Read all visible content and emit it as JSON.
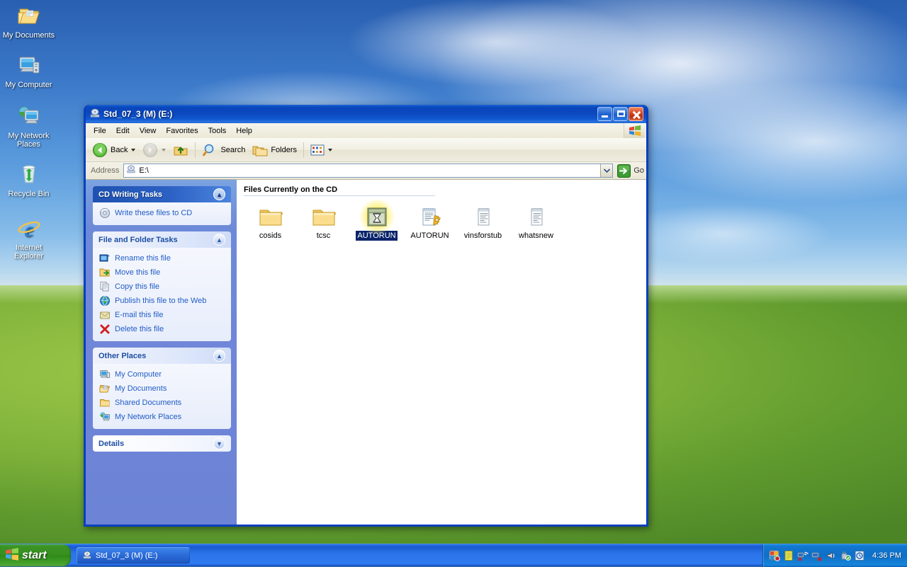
{
  "desktop": {
    "icons": [
      {
        "label": "My Documents",
        "icon": "my-documents-icon"
      },
      {
        "label": "My Computer",
        "icon": "my-computer-icon"
      },
      {
        "label": "My Network Places",
        "icon": "my-network-places-icon"
      },
      {
        "label": "Recycle Bin",
        "icon": "recycle-bin-icon"
      },
      {
        "label": "Internet Explorer",
        "icon": "internet-explorer-icon"
      }
    ]
  },
  "window": {
    "title": "Std_07_3 (M) (E:)",
    "title_icon": "cd-drive-icon",
    "controls": {
      "minimize": "Minimize",
      "maximize": "Maximize",
      "close": "Close"
    },
    "menu": [
      "File",
      "Edit",
      "View",
      "Favorites",
      "Tools",
      "Help"
    ],
    "toolbar": {
      "back": "Back",
      "forward": "Forward",
      "up": "Up",
      "search": "Search",
      "folders": "Folders",
      "views": "Views"
    },
    "address": {
      "label": "Address",
      "value": "E:\\",
      "go": "Go"
    },
    "sidebar": {
      "panels": [
        {
          "title": "CD Writing Tasks",
          "style": "dark",
          "chevron": "chevron-up",
          "items": [
            {
              "label": "Write these files to CD",
              "icon": "cd-write-icon"
            }
          ]
        },
        {
          "title": "File and Folder Tasks",
          "style": "light",
          "chevron": "chevron-up",
          "items": [
            {
              "label": "Rename this file",
              "icon": "rename-icon"
            },
            {
              "label": "Move this file",
              "icon": "move-icon"
            },
            {
              "label": "Copy this file",
              "icon": "copy-icon"
            },
            {
              "label": "Publish this file to the Web",
              "icon": "publish-web-icon"
            },
            {
              "label": "E-mail this file",
              "icon": "email-icon"
            },
            {
              "label": "Delete this file",
              "icon": "delete-icon"
            }
          ]
        },
        {
          "title": "Other Places",
          "style": "light",
          "chevron": "chevron-up",
          "items": [
            {
              "label": "My Computer",
              "icon": "my-computer-icon"
            },
            {
              "label": "My Documents",
              "icon": "my-documents-icon"
            },
            {
              "label": "Shared Documents",
              "icon": "shared-documents-icon"
            },
            {
              "label": "My Network Places",
              "icon": "my-network-places-icon"
            }
          ]
        },
        {
          "title": "Details",
          "style": "light",
          "chevron": "chevron-down",
          "items": []
        }
      ]
    },
    "content": {
      "group_header": "Files Currently on the CD",
      "files": [
        {
          "name": "cosids",
          "type": "folder",
          "selected": false,
          "hover": false
        },
        {
          "name": "tcsc",
          "type": "folder",
          "selected": false,
          "hover": false
        },
        {
          "name": "AUTORUN",
          "type": "application",
          "selected": true,
          "hover": true
        },
        {
          "name": "AUTORUN",
          "type": "setup-information",
          "selected": false,
          "hover": false
        },
        {
          "name": "vinsforstub",
          "type": "text-document",
          "selected": false,
          "hover": false
        },
        {
          "name": "whatsnew",
          "type": "text-document",
          "selected": false,
          "hover": false
        }
      ]
    }
  },
  "taskbar": {
    "start_label": "start",
    "tasks": [
      {
        "label": "Std_07_3 (M) (E:)",
        "icon": "cd-drive-icon",
        "active": true
      }
    ],
    "tray_icons": [
      "security-center-icon",
      "document-icon",
      "network-disconnected-icon",
      "network-error-icon",
      "volume-icon",
      "safely-remove-hardware-icon",
      "windows-update-icon"
    ],
    "clock": "4:36 PM"
  },
  "colors": {
    "title_blue": "#0a45bb",
    "sidebar_blue": "#7086d8",
    "selection_blue": "#0a246a",
    "link_blue": "#215dc6",
    "taskbar_blue": "#2a74e8",
    "start_green": "#37911f",
    "close_red": "#d8401c",
    "hover_glow_yellow": "#fff07a"
  }
}
